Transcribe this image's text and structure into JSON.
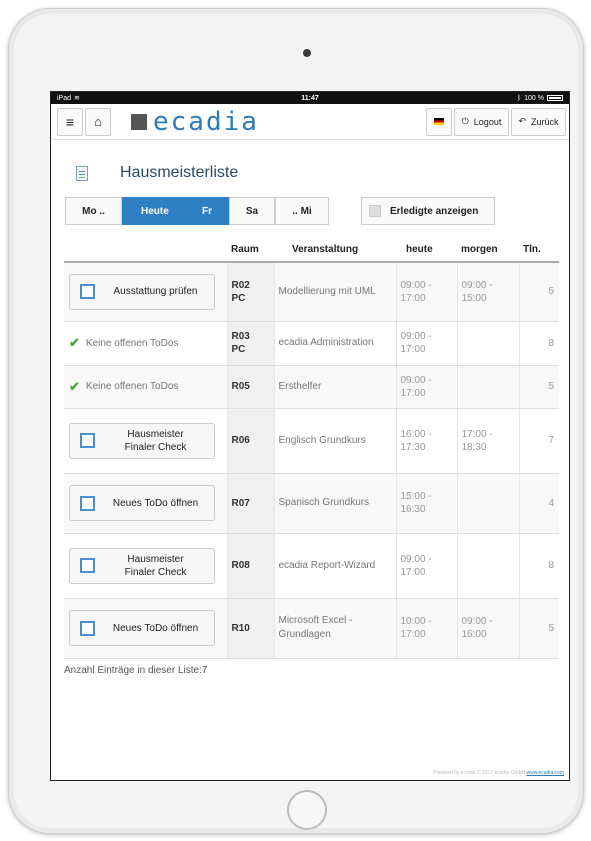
{
  "statusbar": {
    "device": "iPad",
    "time": "11:47",
    "battery": "100 %"
  },
  "nav": {
    "logo": "ecadia",
    "logout": "Logout",
    "back": "Zurück"
  },
  "page": {
    "title": "Hausmeisterliste"
  },
  "days": {
    "prev": "Mo ..",
    "today": "Heute",
    "today_day": "Fr",
    "next": "Sa",
    "later": ".. Mi"
  },
  "done_toggle": "Erledigte anzeigen",
  "table": {
    "headers": {
      "room": "Raum",
      "event": "Veranstaltung",
      "today": "heute",
      "tomorrow": "morgen",
      "participants": "Tln."
    },
    "rows": [
      {
        "todo": "Ausstattung prüfen",
        "room1": "R02",
        "room2": "PC",
        "event": "Modellierung mit UML",
        "today_from": "09:00 -",
        "today_to": "17:00",
        "tomorrow_from": "09:00 -",
        "tomorrow_to": "15:00",
        "participants": "5"
      },
      {
        "status": "Keine offenen ToDos",
        "room1": "R03",
        "room2": "PC",
        "event": "ecadia Administration",
        "today_from": "09:00 -",
        "today_to": "17:00",
        "tomorrow_from": "",
        "tomorrow_to": "",
        "participants": "8"
      },
      {
        "status": "Keine offenen ToDos",
        "room1": "R05",
        "room2": "",
        "event": "Ersthelfer",
        "today_from": "09:00 -",
        "today_to": "17:00",
        "tomorrow_from": "",
        "tomorrow_to": "",
        "participants": "5"
      },
      {
        "todo_line1": "Hausmeister",
        "todo_line2": "Finaler Check",
        "room1": "R06",
        "room2": "",
        "event": "Englisch Grundkurs",
        "today_from": "16:00 -",
        "today_to": "17:30",
        "tomorrow_from": "17:00 -",
        "tomorrow_to": "18:30",
        "participants": "7"
      },
      {
        "todo": "Neues ToDo öffnen",
        "room1": "R07",
        "room2": "",
        "event": "Spanisch Grundkurs",
        "today_from": "15:00 -",
        "today_to": "16:30",
        "tomorrow_from": "",
        "tomorrow_to": "",
        "participants": "4"
      },
      {
        "todo_line1": "Hausmeister",
        "todo_line2": "Finaler Check",
        "room1": "R08",
        "room2": "",
        "event": "ecadia Report-Wizard",
        "today_from": "09:00 -",
        "today_to": "17:00",
        "tomorrow_from": "",
        "tomorrow_to": "",
        "participants": "8"
      },
      {
        "todo": "Neues ToDo öffnen",
        "room1": "R10",
        "room2": "",
        "event_line1": "Microsoft Excel -",
        "event_line2": "Grundlagen",
        "today_from": "10:00 -",
        "today_to": "17:00",
        "tomorrow_from": "09:00 -",
        "tomorrow_to": "16:00",
        "participants": "5"
      }
    ]
  },
  "footer": {
    "count": "Anzahl Einträge in dieser Liste:7",
    "powered": "Powered by ecadia © 2017 ecadia GmbH",
    "powered_link": "www.ecadia.com"
  },
  "colors": {
    "accent": "#2f7fc4",
    "logo": "#2b7bb9",
    "check": "#55a545"
  }
}
